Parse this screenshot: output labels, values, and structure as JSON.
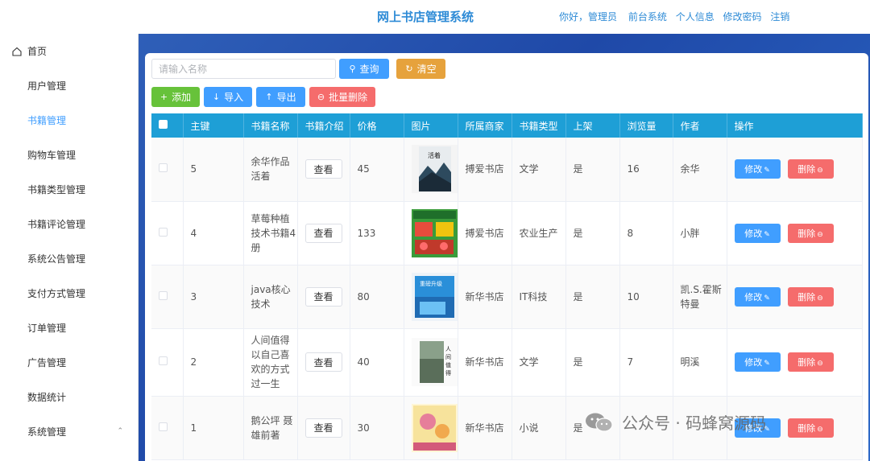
{
  "header": {
    "title": "网上书店管理系统",
    "greeting": "你好，管理员",
    "links": [
      "前台系统",
      "个人信息",
      "修改密码",
      "注销"
    ]
  },
  "sidebar": {
    "items": [
      {
        "label": "首页",
        "icon": "home-icon"
      },
      {
        "label": "用户管理",
        "icon": "grid-icon"
      },
      {
        "label": "书籍管理",
        "icon": "grid-icon"
      },
      {
        "label": "购物车管理",
        "icon": "grid-icon"
      },
      {
        "label": "书籍类型管理",
        "icon": "grid-icon"
      },
      {
        "label": "书籍评论管理",
        "icon": "grid-icon"
      },
      {
        "label": "系统公告管理",
        "icon": "grid-icon"
      },
      {
        "label": "支付方式管理",
        "icon": "grid-icon"
      },
      {
        "label": "订单管理",
        "icon": "grid-icon"
      },
      {
        "label": "广告管理",
        "icon": "grid-icon"
      },
      {
        "label": "数据统计",
        "icon": "grid-icon"
      },
      {
        "label": "系统管理",
        "icon": "apps-icon"
      }
    ],
    "active_index": 2,
    "accent": "#409eff"
  },
  "search": {
    "placeholder": "请输入名称",
    "query_label": "查询",
    "clear_label": "清空"
  },
  "toolbar": {
    "add_label": "添加",
    "import_label": "导入",
    "export_label": "导出",
    "batch_delete_label": "批量删除"
  },
  "table": {
    "columns": [
      "主键",
      "书籍名称",
      "书籍介绍",
      "价格",
      "图片",
      "所属商家",
      "书籍类型",
      "上架",
      "浏览量",
      "作者",
      "操作"
    ],
    "view_label": "查看",
    "edit_label": "修改",
    "delete_label": "删除",
    "header_color": "#1e9fd6",
    "rows": [
      {
        "id": "5",
        "name": "余华作品 活着",
        "price": "45",
        "shop": "搏爱书店",
        "type": "文学",
        "on_shelf": "是",
        "views": "16",
        "author": "余华",
        "cover": "dark-mountain"
      },
      {
        "id": "4",
        "name": "草莓种植技术书籍4册",
        "price": "133",
        "shop": "搏爱书店",
        "type": "农业生产",
        "on_shelf": "是",
        "views": "8",
        "author": "小胖",
        "cover": "green-strawberry"
      },
      {
        "id": "3",
        "name": "java核心技术",
        "price": "80",
        "shop": "新华书店",
        "type": "IT科技",
        "on_shelf": "是",
        "views": "10",
        "author": "凯.S.霍斯特曼",
        "cover": "blue-tech"
      },
      {
        "id": "2",
        "name": "人间值得以自己喜欢的方式过一生",
        "price": "40",
        "shop": "新华书店",
        "type": "文学",
        "on_shelf": "是",
        "views": "7",
        "author": "明溪",
        "cover": "white-forest"
      },
      {
        "id": "1",
        "name": "鹅公坪 聂雄前著",
        "price": "30",
        "shop": "新华书店",
        "type": "小说",
        "on_shelf": "是",
        "views": "",
        "author": "",
        "cover": "yellow-pink"
      }
    ]
  },
  "watermark": {
    "text": "公众号 · 码蜂窝源码"
  }
}
